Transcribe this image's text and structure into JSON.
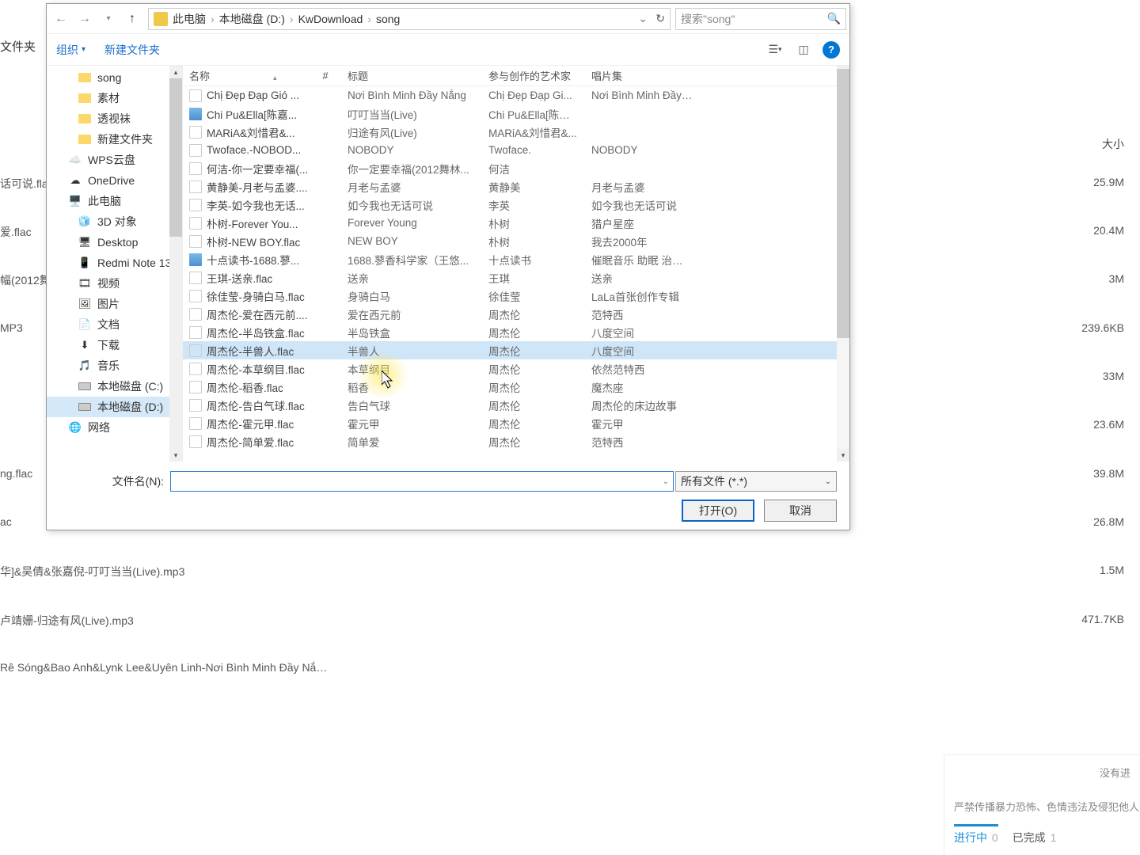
{
  "bg_header": "文件夹",
  "bg_left_items": [
    "话可说.fla",
    "爱.flac",
    "幅(2012舞",
    "MP3",
    "ng.flac",
    "ac",
    "华]&吴倩&张嘉倪-叮叮当当(Live).mp3",
    "卢靖姗-归途有风(Live).mp3",
    "Rê Sóng&Bao Anh&Lynk Lee&Uyên Linh-Nơi Bình Minh Đầy Nắ…"
  ],
  "bg_sizes_label": "大小",
  "bg_sizes": [
    "25.9M",
    "20.4M",
    "3M",
    "239.6KB",
    "33M",
    "23.6M",
    "39.8M",
    "26.8M",
    "1.5M",
    "471.7KB"
  ],
  "breadcrumb": [
    "此电脑",
    "本地磁盘 (D:)",
    "KwDownload",
    "song"
  ],
  "search_placeholder": "搜索\"song\"",
  "toolbar": {
    "organize": "组织",
    "newfolder": "新建文件夹"
  },
  "sidebar": [
    {
      "label": "song",
      "icon": "folder",
      "indent": true
    },
    {
      "label": "素材",
      "icon": "folder",
      "indent": true
    },
    {
      "label": "透视袜",
      "icon": "folder",
      "indent": true
    },
    {
      "label": "新建文件夹",
      "icon": "folder",
      "indent": true
    },
    {
      "label": "WPS云盘",
      "icon": "wps",
      "indent": false
    },
    {
      "label": "OneDrive",
      "icon": "onedrive",
      "indent": false
    },
    {
      "label": "此电脑",
      "icon": "pc",
      "indent": false
    },
    {
      "label": "3D 对象",
      "icon": "3d",
      "indent": true
    },
    {
      "label": "Desktop",
      "icon": "desktop",
      "indent": true
    },
    {
      "label": "Redmi Note 13",
      "icon": "phone",
      "indent": true
    },
    {
      "label": "视频",
      "icon": "video",
      "indent": true
    },
    {
      "label": "图片",
      "icon": "image",
      "indent": true
    },
    {
      "label": "文档",
      "icon": "doc",
      "indent": true
    },
    {
      "label": "下载",
      "icon": "download",
      "indent": true
    },
    {
      "label": "音乐",
      "icon": "music",
      "indent": true
    },
    {
      "label": "本地磁盘 (C:)",
      "icon": "drive",
      "indent": true
    },
    {
      "label": "本地磁盘 (D:)",
      "icon": "drive",
      "indent": true,
      "selected": true
    },
    {
      "label": "网络",
      "icon": "network",
      "indent": false
    }
  ],
  "columns": {
    "name": "名称",
    "num": "#",
    "title": "标题",
    "artist": "参与创作的艺术家",
    "album": "唱片集"
  },
  "files": [
    {
      "name": "Chị Đẹp Đạp Gió ...",
      "title": "Nơi Bình Minh Đầy Nắng",
      "artist": "Chị Đẹp Đạp Gi...",
      "album": "Nơi Bình Minh Đầy ..."
    },
    {
      "name": "Chi Pu&Ella[陈嘉...",
      "title": "叮叮当当(Live)",
      "artist": "Chi Pu&Ella[陈嘉...",
      "album": "",
      "audio": true
    },
    {
      "name": "MARiA&刘惜君&...",
      "title": "归途有风(Live)",
      "artist": "MARiA&刘惜君&...",
      "album": ""
    },
    {
      "name": "Twoface.-NOBOD...",
      "title": "NOBODY",
      "artist": "Twoface.",
      "album": "NOBODY"
    },
    {
      "name": "何洁-你一定要幸福(...",
      "title": "你一定要幸福(2012舞林...",
      "artist": "何洁",
      "album": ""
    },
    {
      "name": "黄静美-月老与孟婆....",
      "title": "月老与孟婆",
      "artist": "黄静美",
      "album": "月老与孟婆"
    },
    {
      "name": "李英-如今我也无话...",
      "title": "如今我也无话可说",
      "artist": "李英",
      "album": "如今我也无话可说"
    },
    {
      "name": "朴树-Forever You...",
      "title": "Forever Young",
      "artist": "朴树",
      "album": "猎户星座"
    },
    {
      "name": "朴树-NEW BOY.flac",
      "title": "NEW BOY",
      "artist": "朴树",
      "album": "我去2000年"
    },
    {
      "name": "十点读书-1688.蓼...",
      "title": "1688.蓼香科学家（王悠...",
      "artist": "十点读书",
      "album": "催眠音乐 助眠 治愈 ...",
      "audio": true
    },
    {
      "name": "王琪-送亲.flac",
      "title": "送亲",
      "artist": "王琪",
      "album": "送亲"
    },
    {
      "name": "徐佳莹-身骑白马.flac",
      "title": "身骑白马",
      "artist": "徐佳莹",
      "album": "LaLa首张创作专辑"
    },
    {
      "name": "周杰伦-爱在西元前....",
      "title": "爱在西元前",
      "artist": "周杰伦",
      "album": "范特西"
    },
    {
      "name": "周杰伦-半岛铁盒.flac",
      "title": "半岛铁盒",
      "artist": "周杰伦",
      "album": "八度空间"
    },
    {
      "name": "周杰伦-半兽人.flac",
      "title": "半兽人",
      "artist": "周杰伦",
      "album": "八度空间",
      "highlight": true
    },
    {
      "name": "周杰伦-本草纲目.flac",
      "title": "本草纲目",
      "artist": "周杰伦",
      "album": "依然范特西"
    },
    {
      "name": "周杰伦-稻香.flac",
      "title": "稻香",
      "artist": "周杰伦",
      "album": "魔杰座"
    },
    {
      "name": "周杰伦-告白气球.flac",
      "title": "告白气球",
      "artist": "周杰伦",
      "album": "周杰伦的床边故事"
    },
    {
      "name": "周杰伦-霍元甲.flac",
      "title": "霍元甲",
      "artist": "周杰伦",
      "album": "霍元甲"
    },
    {
      "name": "周杰伦-简单爱.flac",
      "title": "简单爱",
      "artist": "周杰伦",
      "album": "范特西"
    }
  ],
  "filename_label": "文件名(N):",
  "filetype": "所有文件 (*.*)",
  "open_btn": "打开(O)",
  "cancel_btn": "取消",
  "br": {
    "noresult": "没有进",
    "warn": "严禁传播暴力恐怖、色情违法及侵犯他人合法",
    "inprogress": "进行中",
    "inprogress_n": "0",
    "done": "已完成",
    "done_n": "1"
  }
}
